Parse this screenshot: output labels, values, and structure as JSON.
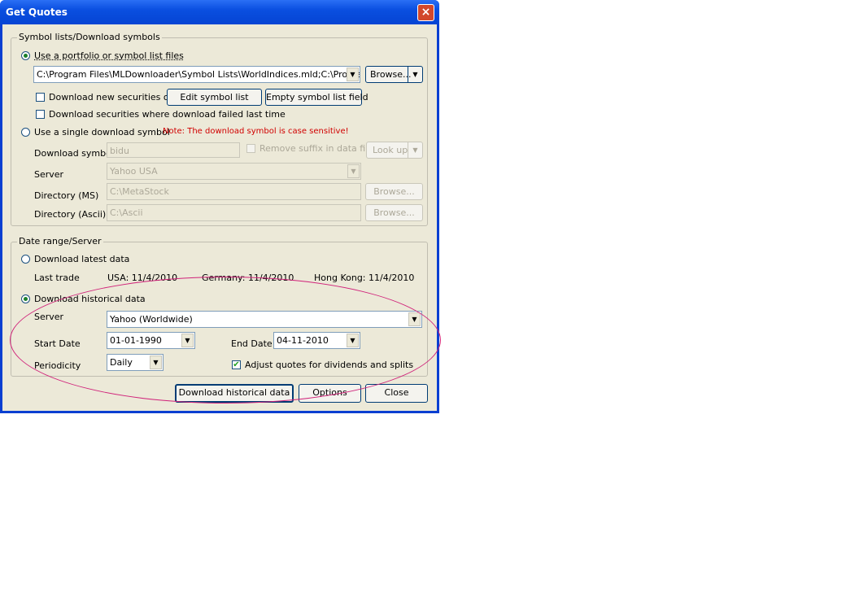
{
  "window": {
    "title": "Get Quotes",
    "close_icon": "×"
  },
  "symbols": {
    "group_label": "Symbol lists/Download symbols",
    "use_portfolio_label": "Use a portfolio or symbol list files",
    "portfolio_path": "C:\\Program Files\\MLDownloader\\Symbol Lists\\WorldIndices.mld;C:\\Program Fil",
    "browse_label": "Browse...",
    "new_only_label": "Download new securities only",
    "edit_symbol_list_label": "Edit symbol list",
    "empty_symbol_list_label": "Empty symbol list field",
    "failed_last_label": "Download securities where download failed last time",
    "single_symbol_label": "Use a single download symbol",
    "case_note": "Note: The download symbol is case sensitive!",
    "download_symbol_label": "Download symbol",
    "download_symbol_value": "bidu",
    "remove_suffix_label": "Remove suffix in data file",
    "look_up_label": "Look up",
    "server_label": "Server",
    "server_value": "Yahoo USA",
    "dir_ms_label": "Directory (MS)",
    "dir_ms_value": "C:\\MetaStock",
    "dir_ascii_label": "Directory (Ascii)",
    "dir_ascii_value": "C:\\Ascii",
    "browse_ms_label": "Browse...",
    "browse_ascii_label": "Browse..."
  },
  "daterange": {
    "group_label": "Date range/Server",
    "latest_label": "Download latest data",
    "last_trade_label": "Last trade",
    "usa": "USA: 11/4/2010",
    "germany": "Germany: 11/4/2010",
    "hongkong": "Hong Kong: 11/4/2010",
    "historical_label": "Download historical data",
    "server_label": "Server",
    "server_value": "Yahoo (Worldwide)",
    "start_label": "Start Date",
    "start_value": "01-01-1990",
    "end_label": "End Date",
    "end_value": "04-11-2010",
    "periodicity_label": "Periodicity",
    "periodicity_value": "Daily",
    "adjust_label": "Adjust quotes for dividends and splits"
  },
  "footer": {
    "download_label": "Download historical data",
    "options_label": "Options",
    "close_label": "Close"
  },
  "colors": {
    "annotation_ellipse": "#d0237a",
    "note_red": "#d10000"
  }
}
